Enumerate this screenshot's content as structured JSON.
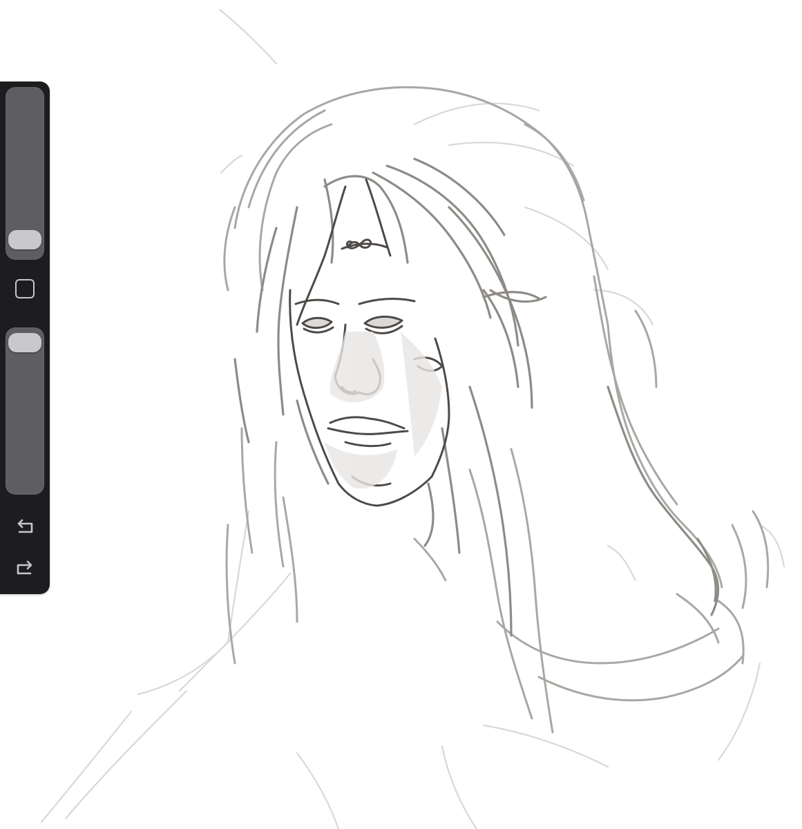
{
  "app": {
    "canvas_background": "#ffffff",
    "sidebar_background": "#1d1d1f",
    "slider_track_color": "#5e5e60",
    "slider_thumb_color": "#c9c9cb",
    "icon_color": "#c7c7c9"
  },
  "sidebar": {
    "brush_size_slider": {
      "level": 0.05
    },
    "modify_button": {
      "icon": "square-outline-icon"
    },
    "brush_opacity_slider": {
      "level": 0.98
    },
    "undo_button": {
      "icon": "undo-arrow-icon"
    },
    "redo_button": {
      "icon": "redo-arrow-icon"
    }
  }
}
